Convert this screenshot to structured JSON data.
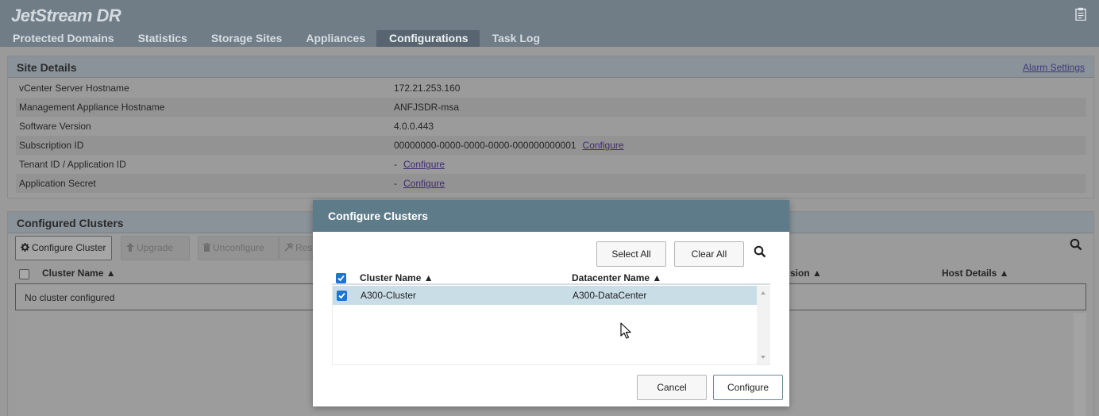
{
  "app": {
    "title": "JetStream DR",
    "clipboard_icon": "clipboard-icon"
  },
  "tabs": [
    {
      "label": "Protected Domains",
      "active": false
    },
    {
      "label": "Statistics",
      "active": false
    },
    {
      "label": "Storage Sites",
      "active": false
    },
    {
      "label": "Appliances",
      "active": false
    },
    {
      "label": "Configurations",
      "active": true
    },
    {
      "label": "Task Log",
      "active": false
    }
  ],
  "site_details": {
    "title": "Site Details",
    "alarm_settings": "Alarm Settings",
    "rows": [
      {
        "label": "vCenter Server Hostname",
        "value": "172.21.253.160",
        "link": ""
      },
      {
        "label": "Management Appliance Hostname",
        "value": "ANFJSDR-msa",
        "link": ""
      },
      {
        "label": "Software Version",
        "value": "4.0.0.443",
        "link": ""
      },
      {
        "label": "Subscription ID",
        "value": "00000000-0000-0000-0000-000000000001",
        "link": "Configure"
      },
      {
        "label": "Tenant ID / Application ID",
        "value": "-",
        "link": "Configure"
      },
      {
        "label": "Application Secret",
        "value": "-",
        "link": "Configure"
      }
    ]
  },
  "configured_clusters": {
    "title": "Configured Clusters",
    "buttons": {
      "configure": "Configure Cluster",
      "upgrade": "Upgrade",
      "unconfigure": "Unconfigure",
      "resolve": "Res"
    },
    "columns": {
      "cluster_name": "Cluster Name ▲",
      "version": "sion ▲",
      "host_details": "Host Details ▲"
    },
    "empty_text": "No cluster configured"
  },
  "modal": {
    "title": "Configure Clusters",
    "select_all": "Select All",
    "clear_all": "Clear All",
    "columns": {
      "cluster_name": "Cluster Name ▲",
      "datacenter_name": "Datacenter Name ▲"
    },
    "rows": [
      {
        "cluster": "A300-Cluster",
        "datacenter": "A300-DataCenter",
        "checked": true
      }
    ],
    "cancel": "Cancel",
    "configure": "Configure"
  },
  "colors": {
    "header_bg": "#707c86",
    "active_tab": "#586570",
    "modal_header": "#5e7b89",
    "checkbox": "#1e73d6",
    "selected_row": "#c8dde6"
  }
}
